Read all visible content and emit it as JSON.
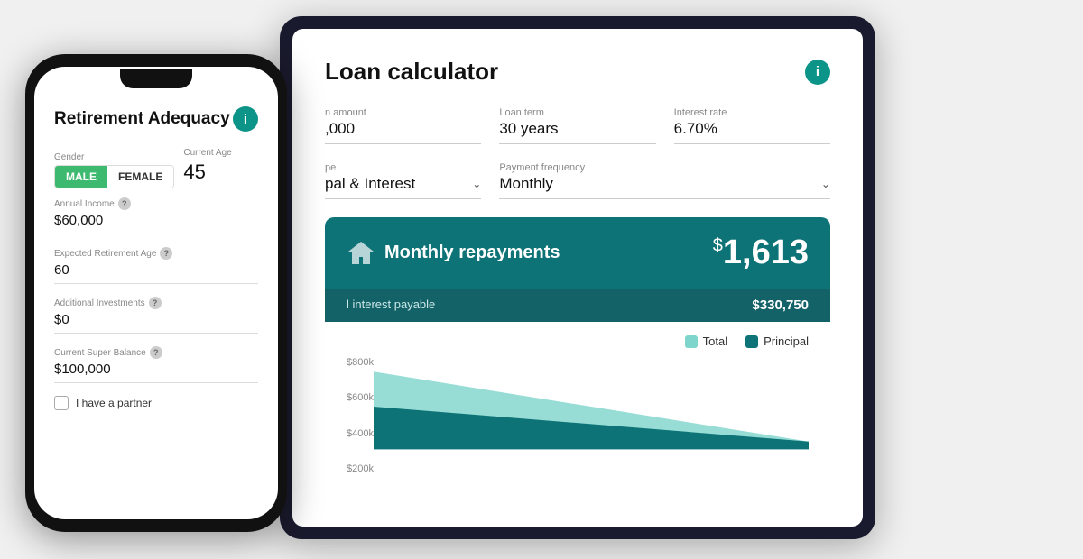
{
  "tablet": {
    "title": "Loan calculator",
    "info_icon": "i",
    "fields_row1": [
      {
        "label": "n amount",
        "value": ",000",
        "type": "text"
      },
      {
        "label": "Loan term",
        "value": "30 years",
        "type": "text"
      },
      {
        "label": "Interest rate",
        "value": "6.70%",
        "type": "text"
      }
    ],
    "fields_row2": [
      {
        "label": "pe",
        "value": "pal & Interest",
        "type": "dropdown"
      },
      {
        "label": "Payment frequency",
        "value": "Monthly",
        "type": "dropdown"
      }
    ],
    "banner": {
      "label": "Monthly repayments",
      "amount": "1,613",
      "currency": "$"
    },
    "sub_banner": {
      "label": "l interest payable",
      "value": "$330,750"
    },
    "chart": {
      "legend": [
        {
          "label": "Total",
          "color_class": "legend-total"
        },
        {
          "label": "Principal",
          "color_class": "legend-principal"
        }
      ],
      "y_labels": [
        "$800k",
        "$600k",
        "$400k",
        "$200k"
      ]
    }
  },
  "phone": {
    "title": "Retirement Adequacy",
    "info_icon": "i",
    "gender_label": "Gender",
    "gender_options": [
      {
        "label": "MALE",
        "active": true
      },
      {
        "label": "FEMALE",
        "active": false
      }
    ],
    "age_label": "Current Age",
    "age_value": "45",
    "fields": [
      {
        "label": "Annual Income",
        "value": "$60,000",
        "has_help": true
      },
      {
        "label": "Expected Retirement Age",
        "value": "60",
        "has_help": true
      },
      {
        "label": "Additional Investments",
        "value": "$0",
        "has_help": true
      },
      {
        "label": "Current Super Balance",
        "value": "$100,000",
        "has_help": true
      }
    ],
    "checkbox_label": "I have a partner"
  }
}
